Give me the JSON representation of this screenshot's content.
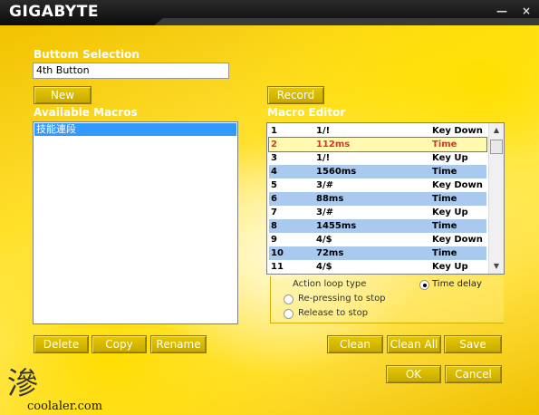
{
  "app": {
    "logo": "GIGABYTE",
    "minimize_glyph": "—",
    "close_glyph": "×"
  },
  "button_selection": {
    "label": "Buttom Selection",
    "value": "4th Button"
  },
  "buttons": {
    "new": "New",
    "record": "Record",
    "delete": "Delete",
    "copy": "Copy",
    "rename": "Rename",
    "clean": "Clean",
    "clean_all": "Clean All",
    "save": "Save",
    "ok": "OK",
    "cancel": "Cancel"
  },
  "available_macros": {
    "label": "Available Macros",
    "items": [
      "技能連段"
    ]
  },
  "macro_editor": {
    "label": "Macro Editor",
    "rows": [
      {
        "index": "1",
        "value": "1/!",
        "action": "Key Down"
      },
      {
        "index": "2",
        "value": "112ms",
        "action": "Time",
        "selected": true
      },
      {
        "index": "3",
        "value": "1/!",
        "action": "Key Up"
      },
      {
        "index": "4",
        "value": "1560ms",
        "action": "Time"
      },
      {
        "index": "5",
        "value": "3/#",
        "action": "Key Down"
      },
      {
        "index": "6",
        "value": "88ms",
        "action": "Time"
      },
      {
        "index": "7",
        "value": "3/#",
        "action": "Key Up"
      },
      {
        "index": "8",
        "value": "1455ms",
        "action": "Time"
      },
      {
        "index": "9",
        "value": "4/$",
        "action": "Key Down"
      },
      {
        "index": "10",
        "value": "72ms",
        "action": "Time"
      },
      {
        "index": "11",
        "value": "4/$",
        "action": "Key Up"
      }
    ]
  },
  "loop": {
    "title": "Action loop type",
    "options": {
      "time_delay": "Time delay",
      "repressing": "Re-pressing to stop",
      "release": "Release to stop"
    },
    "selected": "time_delay"
  },
  "watermark": {
    "glyph": "滲",
    "site": "coolaler.com"
  },
  "colors": {
    "accent_yellow": "#f1c200",
    "button_face": "#d8b800",
    "selection_blue": "#3399ff",
    "row_alt": "#a9c9ee",
    "selected_text": "#e03030"
  }
}
